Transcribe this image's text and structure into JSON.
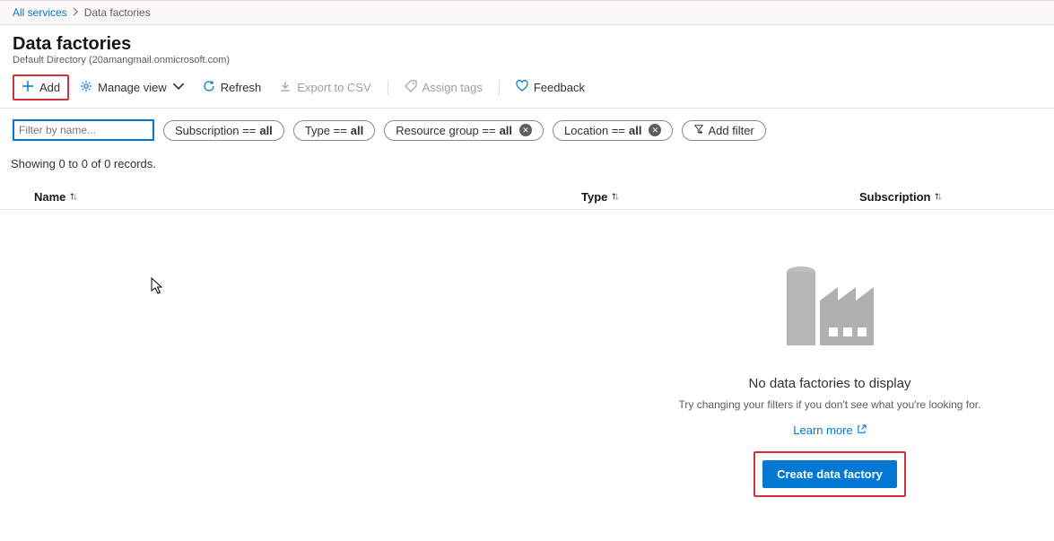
{
  "breadcrumb": {
    "root_label": "All services",
    "current": "Data factories"
  },
  "header": {
    "title": "Data factories",
    "subtitle": "Default Directory (20amangmail.onmicrosoft.com)"
  },
  "commands": {
    "add": "Add",
    "manage_view": "Manage view",
    "refresh": "Refresh",
    "export_csv": "Export to CSV",
    "assign_tags": "Assign tags",
    "feedback": "Feedback"
  },
  "filters": {
    "name_placeholder": "Filter by name...",
    "subscription": {
      "label": "Subscription == ",
      "value": "all"
    },
    "type": {
      "label": "Type == ",
      "value": "all"
    },
    "resource_group": {
      "label": "Resource group == ",
      "value": "all"
    },
    "location": {
      "label": "Location == ",
      "value": "all"
    },
    "add_filter": "Add filter"
  },
  "records_text": "Showing 0 to 0 of 0 records.",
  "columns": {
    "name": "Name",
    "type": "Type",
    "subscription": "Subscription"
  },
  "empty": {
    "title": "No data factories to display",
    "subtitle": "Try changing your filters if you don't see what you're looking for.",
    "learn_more": "Learn more",
    "create_label": "Create data factory"
  }
}
